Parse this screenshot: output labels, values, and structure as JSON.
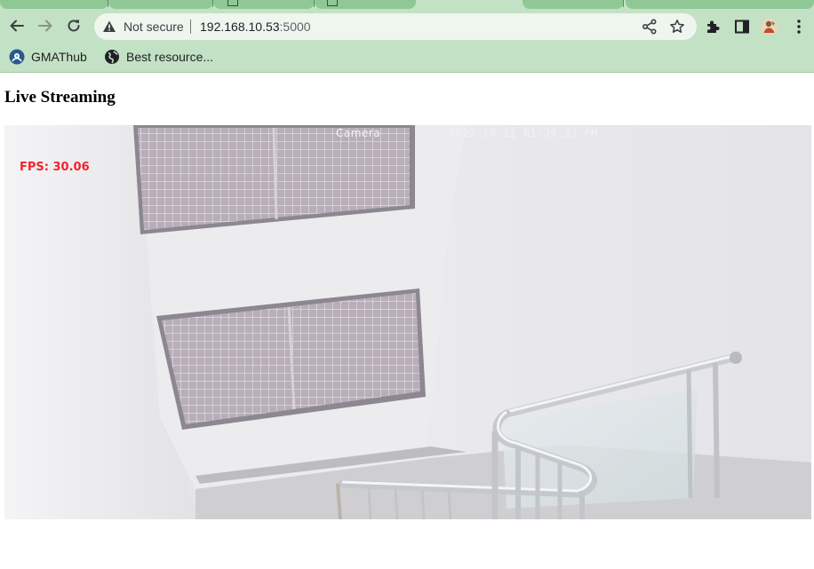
{
  "browser": {
    "address_bar": {
      "security_label": "Not secure",
      "url_host": "192.168.10.53",
      "url_port": ":5000"
    },
    "bookmarks": [
      {
        "label": "GMAThub",
        "icon": "gmathub-icon"
      },
      {
        "label": "Best resource...",
        "icon": "globe-icon"
      }
    ],
    "theme": {
      "frame": "#c3e1c4",
      "omnibox": "#eef6ee"
    }
  },
  "page": {
    "title": "Live Streaming",
    "stream": {
      "camera_label": "Camera",
      "timestamp": "2022-10-11 01:39:33 PM",
      "fps_label": "FPS: 30.06",
      "fps_color": "#f2242c"
    }
  }
}
